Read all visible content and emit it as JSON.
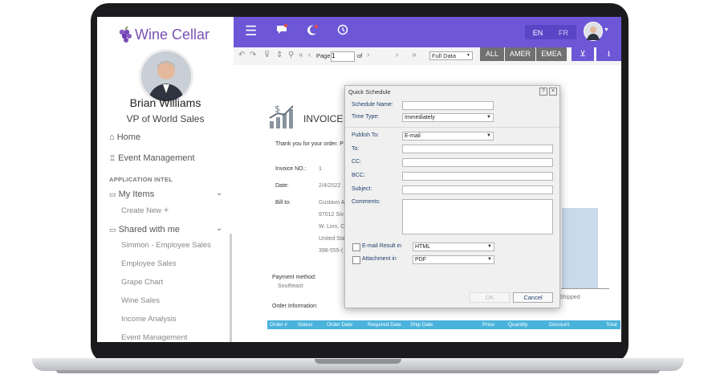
{
  "brand": {
    "name": "Wine Cellar",
    "color": "#7a52b3"
  },
  "user": {
    "name": "Brian Williams",
    "role": "VP of World Sales"
  },
  "nav": {
    "home": "Home",
    "event_management": "Event Management",
    "section_label": "APPLICATION INTEL",
    "my_items": "My Items",
    "create_new": "Create New",
    "shared": "Shared with me",
    "shared_items": [
      "Simmon - Employee Sales",
      "Employee Sales",
      "Grape Chart",
      "Wine Sales",
      "Income Analysis",
      "Event Management"
    ]
  },
  "header": {
    "accent": "#6d57d6",
    "lang": [
      "EN",
      "FR"
    ]
  },
  "toolbar": {
    "page_label": "Page",
    "page_value": "1",
    "of_label": "of",
    "data_select": "Full Data",
    "regions": [
      "ALL",
      "AMER",
      "EMEA"
    ]
  },
  "report": {
    "title": "INVOICE",
    "thanks": "Thank you for your order. P",
    "invoice_no_label": "Invoice NO.:",
    "invoice_no": "1",
    "date_label": "Date:",
    "date": "2/4/2022",
    "bill_to_label": "Bill to:",
    "bill_to_lines": [
      "Gustavo A",
      "97012 Siv",
      "W. Linn, C",
      "United Sta",
      "398-555-("
    ],
    "payment_label": "Payment method:",
    "payment_value": "Southeast",
    "order_info": "Order Information:",
    "shipped": "Shipped",
    "columns": [
      "Order #",
      "Status",
      "Order Date",
      "Required Date",
      "Ship Date",
      "Price",
      "Quantity",
      "Discount",
      "Total"
    ]
  },
  "dialog": {
    "title": "Quick Schedule",
    "help": "?",
    "close": "×",
    "schedule_name_label": "Schedule Name:",
    "time_type_label": "Time Type:",
    "time_type": "Immediately",
    "publish_to_label": "Publish To:",
    "publish_to": "E-mail",
    "to_label": "To:",
    "cc_label": "CC:",
    "bcc_label": "BCC:",
    "subject_label": "Subject:",
    "comments_label": "Comments:",
    "email_result_label": "E-mail Result in",
    "email_result": "HTML",
    "attachment_label": "Attachment in",
    "attachment": "PDF",
    "ok_label": "OK",
    "cancel_label": "Cancel"
  }
}
